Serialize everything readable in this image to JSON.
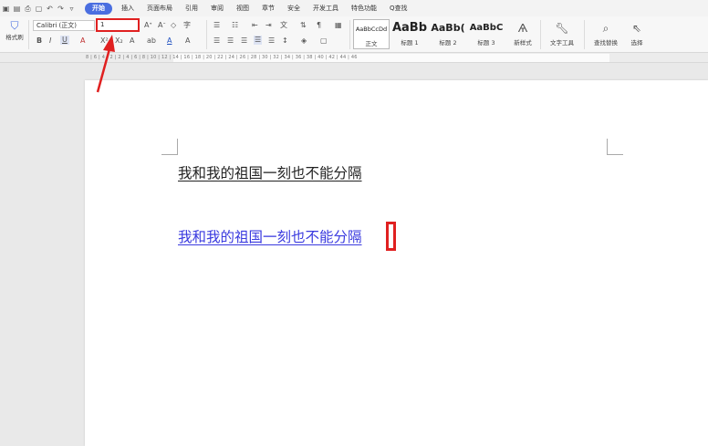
{
  "menu": {
    "tabs": [
      "开始",
      "插入",
      "页面布局",
      "引用",
      "审阅",
      "视图",
      "章节",
      "安全",
      "开发工具",
      "特色功能",
      "Q查找"
    ]
  },
  "ribbon": {
    "format_painter": "格式刷",
    "font_name": "Calibri (正文)",
    "font_size": "1",
    "styles": [
      {
        "preview": "AaBbCcDd",
        "name": "正文"
      },
      {
        "preview": "AaBb",
        "name": "标题 1"
      },
      {
        "preview": "AaBb(",
        "name": "标题 2"
      },
      {
        "preview": "AaBbC",
        "name": "标题 3"
      }
    ],
    "new_style": "新样式",
    "text_tools": "文字工具",
    "find_replace": "查找替换",
    "select": "选择"
  },
  "ruler": {
    "numbers": "8 | 6 | 4 | 2 | 2 | 4 | 6 | 8 | 10 | 12 | 14 | 16 | 18 | 20 | 22 | 24 | 26 | 28 | 30 | 32 | 34 | 36 | 38 | 40 | 42 | 44 | 46"
  },
  "document": {
    "line1": "我和我的祖国一刻也不能分隔",
    "line2": "我和我的祖国一刻也不能分隔"
  },
  "colors": {
    "accent": "#4a6ee0",
    "highlight": "#e02020",
    "link_text": "#3a3adf"
  }
}
